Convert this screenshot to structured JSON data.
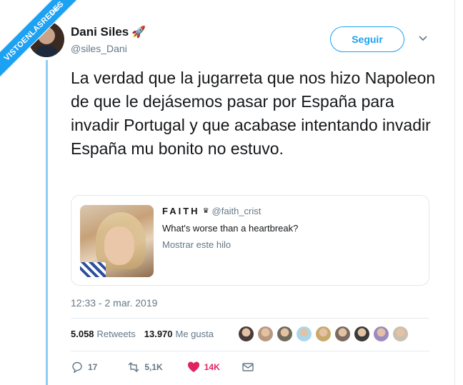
{
  "watermark": {
    "text": "VISTOENLASREDES",
    "sub": ".com"
  },
  "author": {
    "name": "Dani Siles",
    "emoji": "🚀",
    "handle": "@siles_Dani"
  },
  "follow_label": "Seguir",
  "tweet_text": "La verdad que la jugarreta que nos hizo Napoleon de que le dejásemos pasar por España para invadir Portugal y que acabase intentando invadir España mu bonito no estuvo.",
  "quote": {
    "name": "FAITH",
    "badge": "♛",
    "handle": "@faith_crist",
    "text": "What's worse than a heartbreak?",
    "thread_label": "Mostrar este hilo"
  },
  "timestamp": "12:33 - 2 mar. 2019",
  "stats": {
    "retweets_count": "5.058",
    "retweets_label": "Retweets",
    "likes_count": "13.970",
    "likes_label": "Me gusta"
  },
  "liker_colors": [
    "#4a3b3b",
    "#b89880",
    "#6e6a5c",
    "#a8d8f0",
    "#c9a86a",
    "#7a6a60",
    "#3a3a3a",
    "#9a8cc0",
    "#c8c0b0"
  ],
  "actions": {
    "replies": "17",
    "retweets": "5,1K",
    "likes": "14K"
  },
  "colors": {
    "accent": "#1da1f2",
    "like": "#e0245e",
    "muted": "#657786"
  }
}
